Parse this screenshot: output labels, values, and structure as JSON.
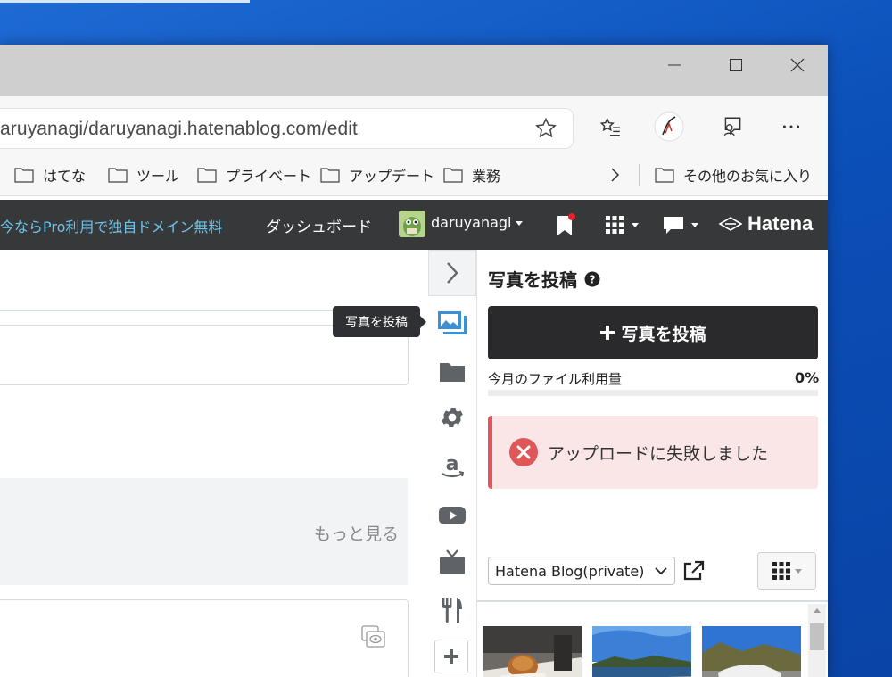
{
  "browser": {
    "address": "aruyanagi/daruyanagi.hatenablog.com/edit",
    "bookmarks": [
      "はてな",
      "ツール",
      "プライベート",
      "アップデート",
      "業務"
    ],
    "other_favorites": "その他のお気に入り"
  },
  "hatena_bar": {
    "promo": "今ならPro利用で独自ドメイン無料",
    "dashboard": "ダッシュボード",
    "username": "daruyanagi",
    "logo": "Hatena",
    "notification_color": "#e8202a"
  },
  "editor": {
    "more": "もっと見る"
  },
  "rail": {
    "tooltip": "写真を投稿",
    "active_color": "#3a8fd6"
  },
  "panel": {
    "title": "写真を投稿",
    "post_button": "写真を投稿",
    "usage_label": "今月のファイル利用量",
    "usage_value": "0%",
    "usage_fraction": 0,
    "error_message": "アップロードに失敗しました",
    "error_color": "#e0575a",
    "album_select": "Hatena Blog(private)"
  }
}
